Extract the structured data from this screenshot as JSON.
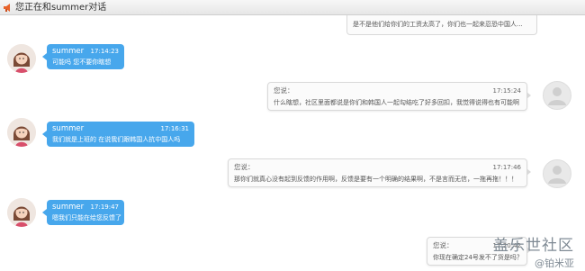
{
  "window": {
    "title": "您正在和summer对话"
  },
  "previous_message": "是不是他们给你们的工资太高了，你们也一起来忍恐中国人...",
  "messages": [
    {
      "side": "in",
      "name": "summer",
      "time": "17:14:23",
      "text": "可能吗 您不要你瞎想"
    },
    {
      "side": "out",
      "name": "您说：",
      "time": "17:15:24",
      "text": "什么瞎想，社区里面都说是你们和韩国人一起勾结吃了好多回扣，我觉得说得也有可能啊"
    },
    {
      "side": "in",
      "name": "summer",
      "time": "17:16:31",
      "text": "我们就是上班的 在说我们跟韩国人抗中国人吗"
    },
    {
      "side": "out",
      "name": "您说：",
      "time": "17:17:46",
      "text": "那你们就真心没有起到反馈的作用啊，反馈是要有一个明确的结果啊，不是言而无信，一拖再拖！！！"
    },
    {
      "side": "in",
      "name": "summer",
      "time": "17:19:47",
      "text": "嗯我们只能在给您反馈了"
    },
    {
      "side": "out",
      "name": "您说：",
      "time": "17:20:42",
      "text": "你现在确定24号发不了货是吗？"
    }
  ],
  "watermark": {
    "main": "盖乐世社区",
    "sub": "@铂米亚"
  },
  "colors": {
    "incoming_bubble": "#47a7ec",
    "outgoing_bubble": "#fbfbfb",
    "title_icon": "#e8632b"
  }
}
